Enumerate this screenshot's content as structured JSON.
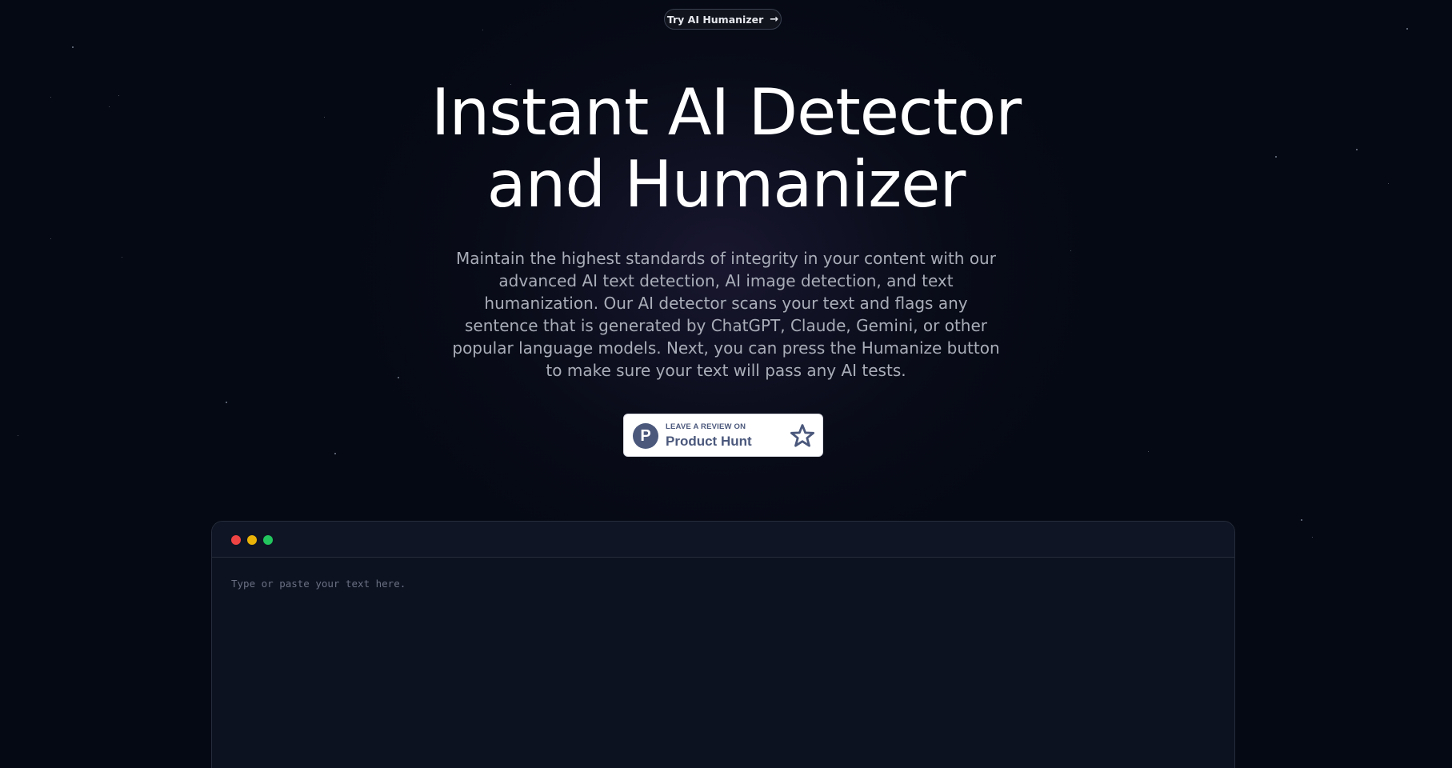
{
  "header": {
    "cta_label": "Try AI Humanizer",
    "cta_icon": "arrow-right-icon"
  },
  "hero": {
    "title_line1": "Instant AI Detector",
    "title_line2": "and Humanizer",
    "description": "Maintain the highest standards of integrity in your content with our advanced AI text detection, AI image detection, and text humanization. Our AI detector scans your text and flags any sentence that is generated by ChatGPT, Claude, Gemini, or other popular language models. Next, you can press the Humanize button to make sure your text will pass any AI tests."
  },
  "product_hunt": {
    "logo_letter": "P",
    "small_label": "LEAVE A REVIEW ON",
    "big_label": "Product Hunt",
    "icon": "star-outline-icon",
    "color": "#4b587c"
  },
  "editor": {
    "placeholder": "Type or paste your text here.",
    "value": "",
    "window_dots": [
      "#ef4444",
      "#eab308",
      "#22c55e"
    ]
  }
}
